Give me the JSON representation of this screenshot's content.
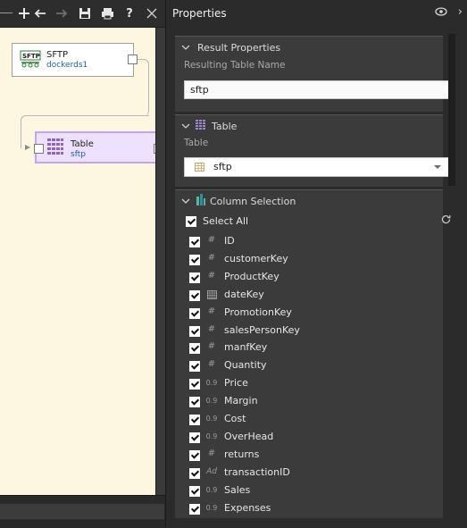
{
  "toolbar": {
    "icons": [
      "add-icon",
      "undo-icon",
      "redo-icon",
      "save-icon",
      "print-icon",
      "help-icon",
      "close-icon"
    ],
    "help_label": "?"
  },
  "canvas": {
    "nodes": [
      {
        "name": "SFTP",
        "sub": "dockerds1",
        "logo_text": "SFTP"
      },
      {
        "name": "Table",
        "sub": "sftp"
      }
    ]
  },
  "properties": {
    "title": "Properties",
    "result_properties": {
      "header": "Result Properties",
      "label": "Resulting Table Name",
      "value": "sftp"
    },
    "table_section": {
      "header": "Table",
      "label": "Table",
      "selected": "sftp"
    },
    "column_selection": {
      "header": "Column Selection",
      "select_all_label": "Select All",
      "columns": [
        {
          "name": "ID",
          "type": "#"
        },
        {
          "name": "customerKey",
          "type": "#"
        },
        {
          "name": "ProductKey",
          "type": "#"
        },
        {
          "name": "dateKey",
          "type": "date"
        },
        {
          "name": "PromotionKey",
          "type": "#"
        },
        {
          "name": "salesPersonKey",
          "type": "#"
        },
        {
          "name": "manfKey",
          "type": "#"
        },
        {
          "name": "Quantity",
          "type": "#"
        },
        {
          "name": "Price",
          "type": "0.9"
        },
        {
          "name": "Margin",
          "type": "0.9"
        },
        {
          "name": "Cost",
          "type": "0.9"
        },
        {
          "name": "OverHead",
          "type": "0.9"
        },
        {
          "name": "returns",
          "type": "#"
        },
        {
          "name": "transactionID",
          "type": "Ad"
        },
        {
          "name": "Sales",
          "type": "0.9"
        },
        {
          "name": "Expenses",
          "type": "0.9"
        }
      ]
    }
  }
}
